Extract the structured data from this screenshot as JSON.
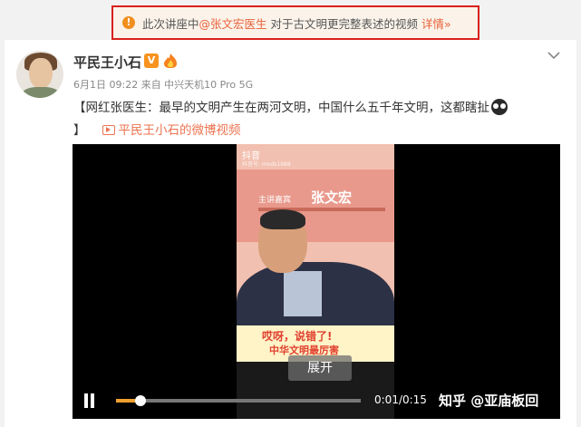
{
  "notice": {
    "prefix": "此次讲座中",
    "mention": "@张文宏医生",
    "suffix": " 对于古文明更完整表述的视频",
    "detail": "详情»"
  },
  "post": {
    "user_name": "平民王小石",
    "meta": "6月1日 09:22 来自 中兴天机10 Pro 5G",
    "text_line1": "【网红张医生：最早的文明产生在两河文明，中国什么五千年文明，这都瞎扯",
    "text_line2_bracket": "】",
    "video_link_label": "平民王小石的微博视频"
  },
  "video": {
    "frame_app": "抖音",
    "frame_id": "抖音号: mods1988",
    "frame_speaker_tag": "主讲嘉宾",
    "frame_speaker_name": "张文宏",
    "frame_caption_line1": "哎呀，说错了!",
    "frame_caption_line2": "中华文明最厉害",
    "expand_label": "展开",
    "current_time": "0:01",
    "duration": "0:15",
    "time_display": "0:01/0:15",
    "progress": 0.1,
    "watermark": "知乎 @亚庙板回"
  },
  "colors": {
    "notice_border": "#d8201c",
    "link_orange": "#eb7350",
    "warn_orange": "#f08e1e"
  },
  "icons": [
    "warning-icon",
    "vip-icon",
    "fire-badge-icon",
    "chevron-down-icon",
    "video-icon",
    "pause-icon"
  ]
}
